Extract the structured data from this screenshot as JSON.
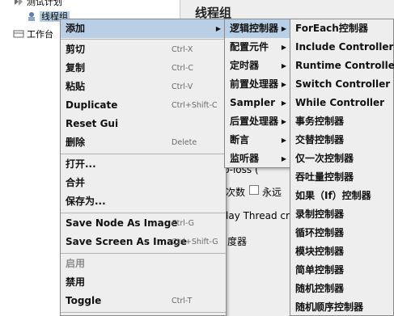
{
  "tree": {
    "item1": "测试计划",
    "item2": "线程组",
    "item3": "工作台"
  },
  "panel": {
    "title": "线程组",
    "frag_loop": "p-loss (",
    "frag_count": "次数",
    "forever": "永远",
    "frag_delay": "lay Thread cr",
    "frag_scheduler": "度器"
  },
  "context_menu": {
    "add": "添加",
    "cut": "剪切",
    "cut_key": "Ctrl-X",
    "copy": "复制",
    "copy_key": "Ctrl-C",
    "paste": "粘贴",
    "paste_key": "Ctrl-V",
    "duplicate": "Duplicate",
    "duplicate_key": "Ctrl+Shift-C",
    "reset_gui": "Reset Gui",
    "delete": "删除",
    "delete_key": "Delete",
    "open": "打开...",
    "merge": "合并",
    "save_as": "保存为...",
    "save_node_image": "Save Node As Image",
    "save_node_image_key": "Ctrl-G",
    "save_screen_image": "Save Screen As Image",
    "save_screen_image_key": "Ctrl+Shift-G",
    "enable": "启用",
    "disable": "禁用",
    "toggle": "Toggle",
    "toggle_key": "Ctrl-T"
  },
  "add_submenu": {
    "logic_controller": "逻辑控制器",
    "config_element": "配置元件",
    "timer": "定时器",
    "pre_processor": "前置处理器",
    "sampler": "Sampler",
    "post_processor": "后置处理器",
    "assertion": "断言",
    "listener": "监听器"
  },
  "logic_submenu": [
    "ForEach控制器",
    "Include Controller",
    "Runtime Controller",
    "Switch Controller",
    "While Controller",
    "事务控制器",
    "交替控制器",
    "仅一次控制器",
    "吞吐量控制器",
    "如果（If）控制器",
    "录制控制器",
    "循环控制器",
    "模块控制器",
    "简单控制器",
    "随机控制器",
    "随机顺序控制器"
  ],
  "colors": {
    "menu_bg": "#eeeeee",
    "highlight": "#b8cfe5",
    "disabled_text": "#8c8c8c",
    "shortcut_text": "#6a6a6a"
  }
}
